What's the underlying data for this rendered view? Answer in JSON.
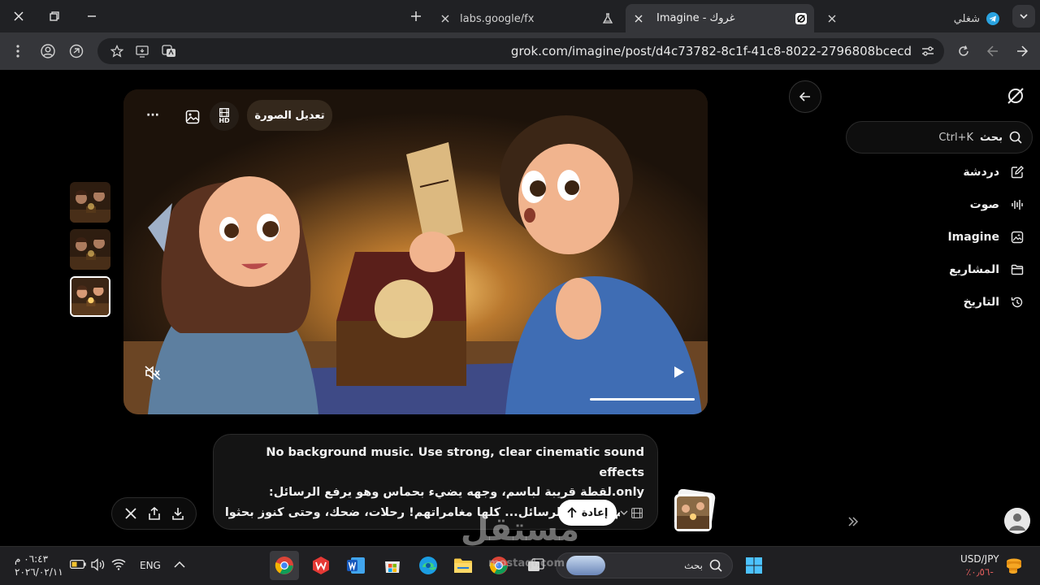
{
  "browser": {
    "tabs": [
      {
        "title": "Imagine - غروك",
        "active": true,
        "favicon": "grok-icon"
      },
      {
        "title": "labs.google/fx",
        "active": false,
        "favicon": "flask-icon"
      },
      {
        "title": "شغلي",
        "active": false,
        "favicon": "telegram-icon"
      }
    ],
    "url": "grok.com/imagine/post/d4c73782-8c1f-41c8-8022-2796808bcecd"
  },
  "sidebar": {
    "search_label": "بحث",
    "search_shortcut": "Ctrl+K",
    "items": [
      {
        "label": "دردشة",
        "icon": "edit-icon"
      },
      {
        "label": "صوت",
        "icon": "waveform-icon"
      },
      {
        "label": "Imagine",
        "icon": "image-spark-icon"
      },
      {
        "label": "المشاريع",
        "icon": "folder-icon"
      },
      {
        "label": "التاريخ",
        "icon": "history-icon"
      }
    ]
  },
  "viewer": {
    "edit_label": "تعديل الصورة",
    "hd_label": "HD",
    "more_label": "···",
    "progress": 0.18
  },
  "prompt": {
    "line1": "No background music. Use strong, clear cinematic sound effects",
    "line2": "only.لقطة قريبة لباسم، وجهه يضيء بحماس وهو يرفع الرسائل:",
    "line3": "باسم: «وهذه الرسائل... كلها مغامراتهم! رحلات، ضحك، وحتى كنوز بحثوا",
    "retry_label": "إعادة"
  },
  "taskbar": {
    "time": "٠٦:٤٣ م",
    "date": "٢٠٢٦/٠٢/١١",
    "lang": "ENG",
    "search_label": "بحث",
    "ticker_name": "USD/JPY",
    "ticker_change": "-٠٫٥٦٪",
    "ticker_color": "#e05d5d"
  },
  "watermark": {
    "word": "مستقل",
    "domain": "mostaql.com"
  },
  "colors": {
    "tab_bg": "#202124",
    "toolbar_bg": "#35363a",
    "page_bg": "#000000"
  }
}
